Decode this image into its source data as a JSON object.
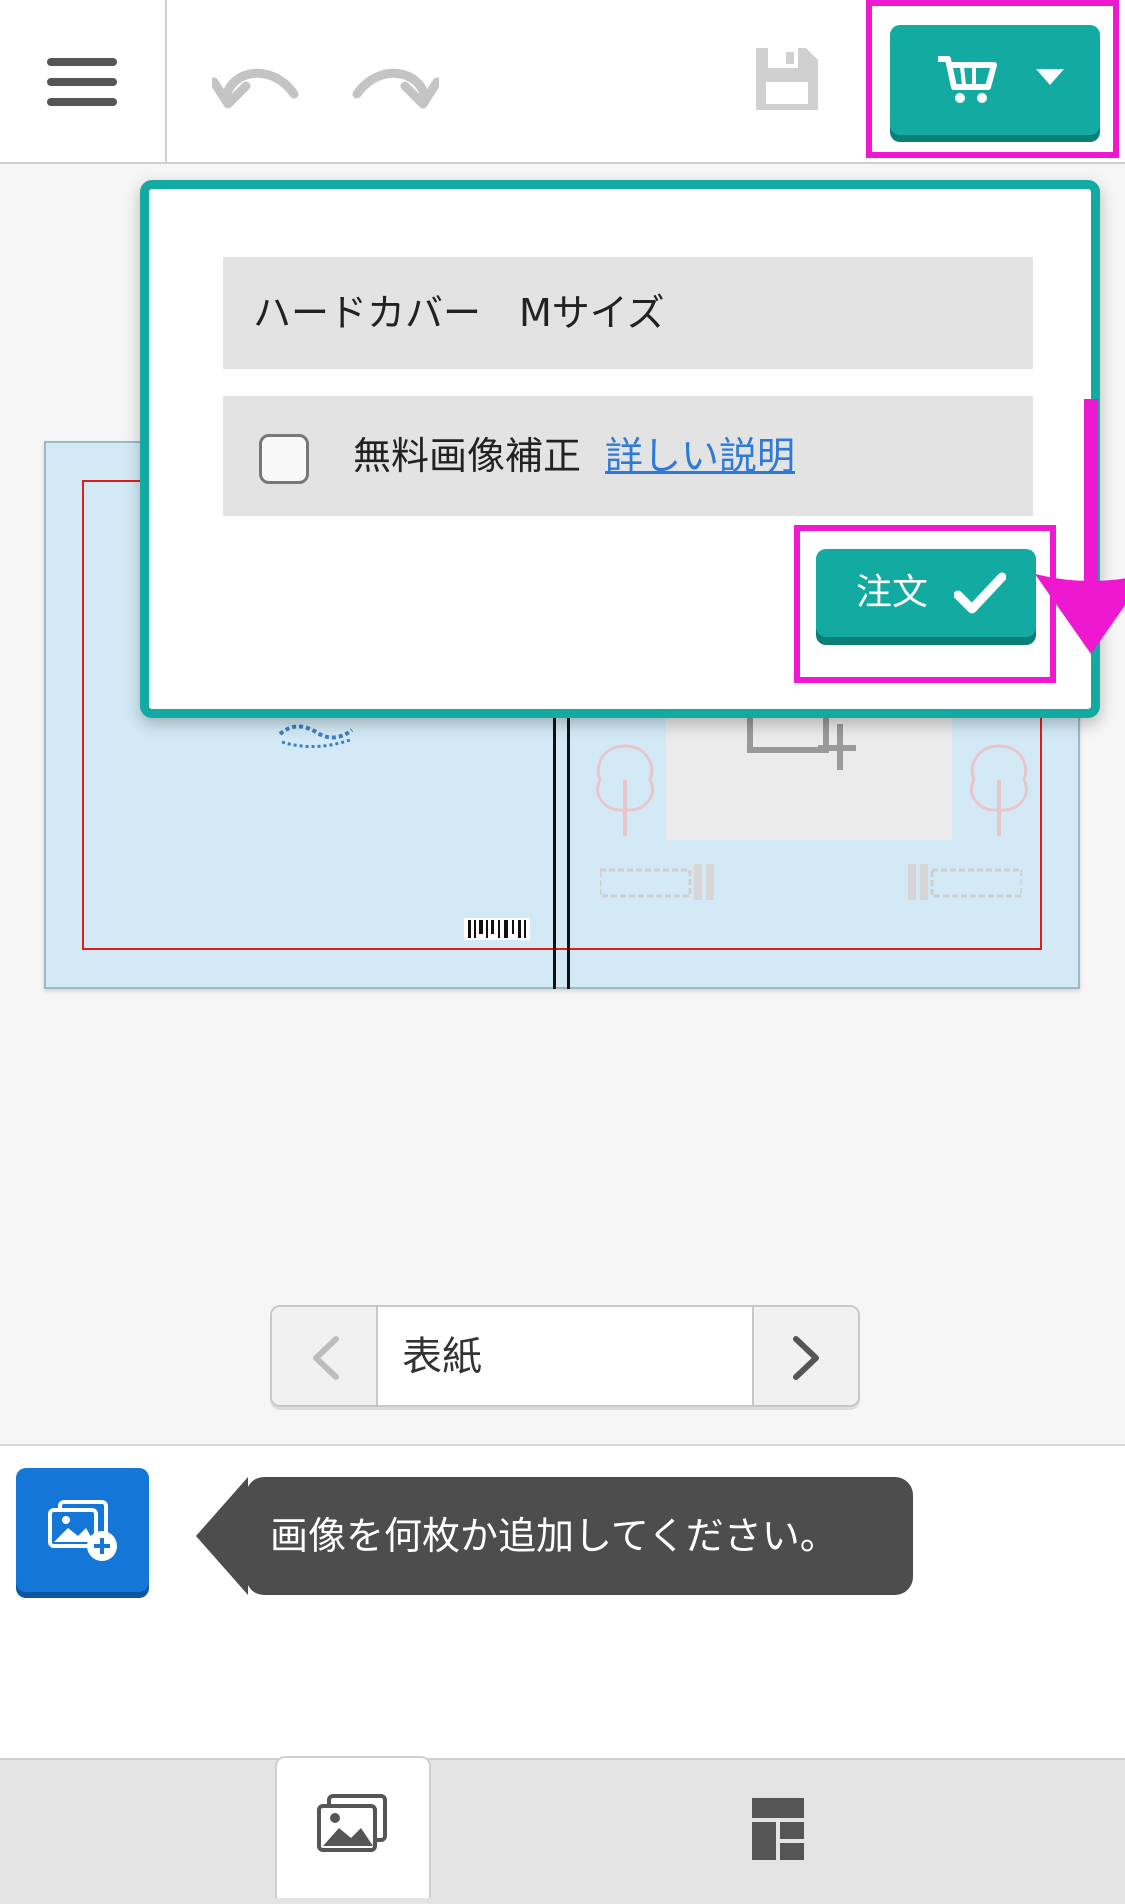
{
  "toolbar": {
    "menu_icon": "hamburger-menu-icon",
    "undo_icon": "undo-icon",
    "redo_icon": "redo-icon",
    "save_icon": "save-icon",
    "cart_icon": "cart-icon",
    "dropdown_icon": "caret-down-icon",
    "accent_color": "#13aaa2",
    "highlight_color": "#ee18d0"
  },
  "order_popup": {
    "product": "ハードカバー　Mサイズ",
    "option_label": "無料画像補正",
    "option_link": "詳しい説明",
    "option_checked": false,
    "order_button": "注文"
  },
  "pager": {
    "current_page": "表紙"
  },
  "tray": {
    "add_images_icon": "add-images-icon",
    "hint": "画像を何枚か追加してください。",
    "button_color": "#1476d6"
  },
  "bottom_tabs": [
    {
      "name": "photos",
      "icon": "photos-icon",
      "active": true
    },
    {
      "name": "layout",
      "icon": "layout-grid-icon",
      "active": false
    }
  ]
}
